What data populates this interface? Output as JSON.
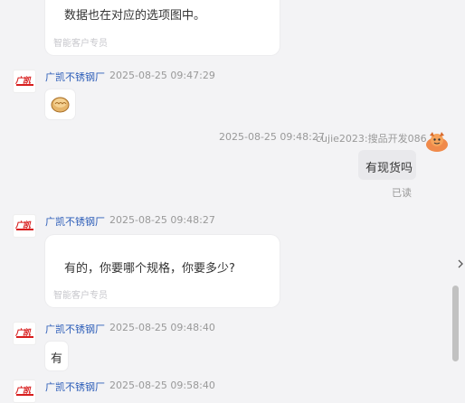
{
  "messages": {
    "m1": {
      "text": "数据也在对应的选项图中。",
      "footer": "智能客户专员"
    },
    "m2": {
      "sender": "广凯不锈钢厂",
      "time": "2025-08-25 09:47:29",
      "sticker": "bread-sticker"
    },
    "m3": {
      "time": "2025-08-25 09:48:27",
      "sender": "cujie2023:搜品开发086",
      "text": "有现货吗",
      "status": "已读"
    },
    "m4": {
      "sender": "广凯不锈钢厂",
      "time": "2025-08-25 09:48:27",
      "text": "有的，你要哪个规格，你要多少?",
      "footer": "智能客户专员"
    },
    "m5": {
      "sender": "广凯不锈钢厂",
      "time": "2025-08-25 09:48:40",
      "text": "有"
    },
    "m6": {
      "sender": "广凯不锈钢厂",
      "time": "2025-08-25 09:58:40"
    }
  },
  "colors": {
    "background": "#f3f3f5",
    "sender_name": "#2b5cb8",
    "logo_red": "#d81e1e",
    "my_bubble": "#e9e9ec"
  },
  "icons": {
    "company_avatar": "company-logo-icon",
    "user_avatar": "cartoon-avatar-icon",
    "collapse": "chevron-right-icon"
  }
}
